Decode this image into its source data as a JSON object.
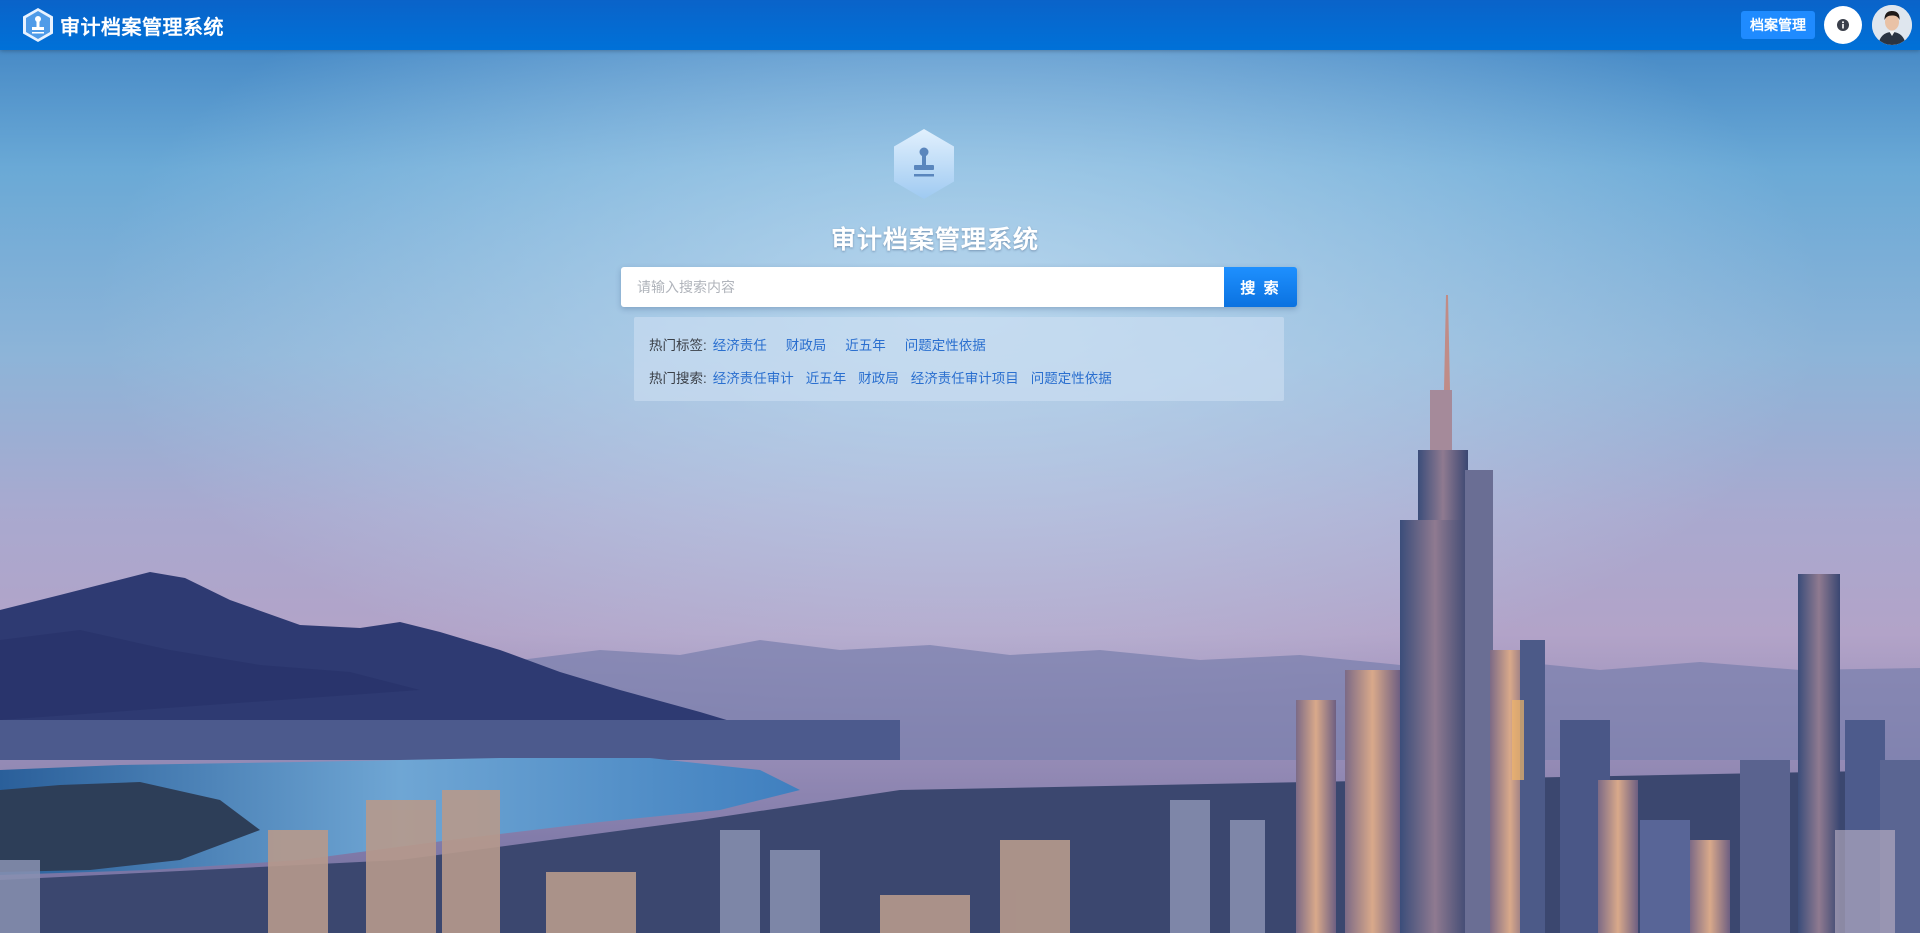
{
  "header": {
    "title": "审计档案管理系统",
    "archive_button": "档案管理",
    "info_icon": "info-icon",
    "avatar": "user-avatar"
  },
  "hero": {
    "logo_icon": "stamp-hexagon-icon",
    "title": "审计档案管理系统"
  },
  "search": {
    "placeholder": "请输入搜索内容",
    "value": "",
    "button": "搜 索"
  },
  "hot_tags": {
    "label": "热门标签:",
    "items": [
      "经济责任",
      "财政局",
      "近五年",
      "问题定性依据"
    ]
  },
  "hot_searches": {
    "label": "热门搜索:",
    "items": [
      "经济责任审计",
      "近五年",
      "财政局",
      "经济责任审计项目",
      "问题定性依据"
    ]
  },
  "colors": {
    "header": "#0a63c9",
    "primary_button": "#1e90ff",
    "link": "#2a6fcf"
  }
}
